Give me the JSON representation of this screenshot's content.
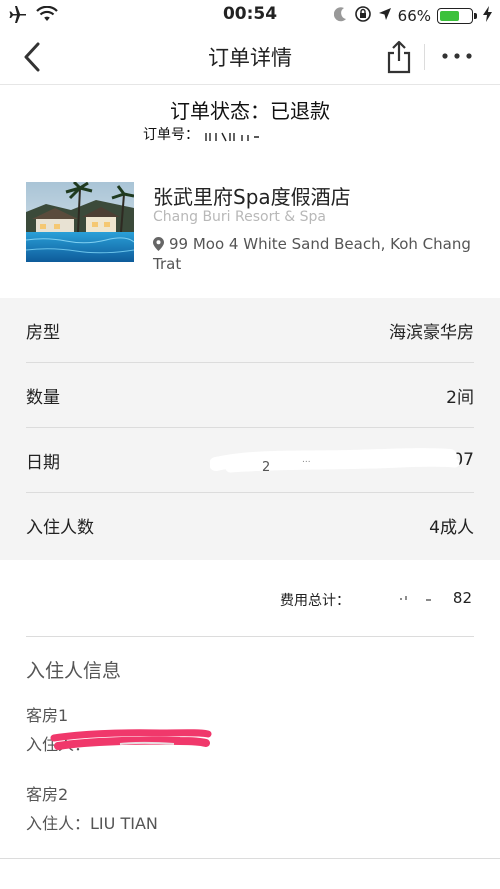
{
  "status_bar": {
    "time": "00:54",
    "battery": "66%",
    "battery_level": 0.66,
    "icons": [
      "airplane-mode-icon",
      "wifi-icon",
      "moon-icon",
      "orientation-lock-icon",
      "location-arrow-icon",
      "battery-icon",
      "charging-bolt-icon"
    ]
  },
  "nav": {
    "title": "订单详情",
    "icons": [
      "back-chevron-icon",
      "share-icon",
      "more-icon"
    ]
  },
  "order": {
    "status_label": "订单状态：已退款",
    "number_label": "订单号："
  },
  "hotel": {
    "name": "张武里府Spa度假酒店",
    "name_en": "Chang Buri Resort & Spa",
    "address": "99 Moo 4 White Sand Beach, Koh Chang Trat",
    "image_alt": "hotel-pool-photo"
  },
  "details": [
    {
      "label": "房型",
      "value": "海滨豪华房"
    },
    {
      "label": "数量",
      "value": "2间"
    },
    {
      "label": "日期",
      "value": "/07"
    },
    {
      "label": "入住人数",
      "value": "4成人"
    }
  ],
  "total": {
    "label": "费用总计：",
    "value": "82"
  },
  "guests": {
    "title": "入住人信息",
    "rooms": [
      {
        "room": "客房1",
        "guest_label": "入住人：",
        "guest_name": ""
      },
      {
        "room": "客房2",
        "guest_label": "入住人：",
        "guest_name": "LIU TIAN"
      }
    ]
  },
  "colors": {
    "battery_green": "#3cc13b",
    "detail_bg": "#f4f4f4",
    "scribble_pink": "#f0386b"
  }
}
